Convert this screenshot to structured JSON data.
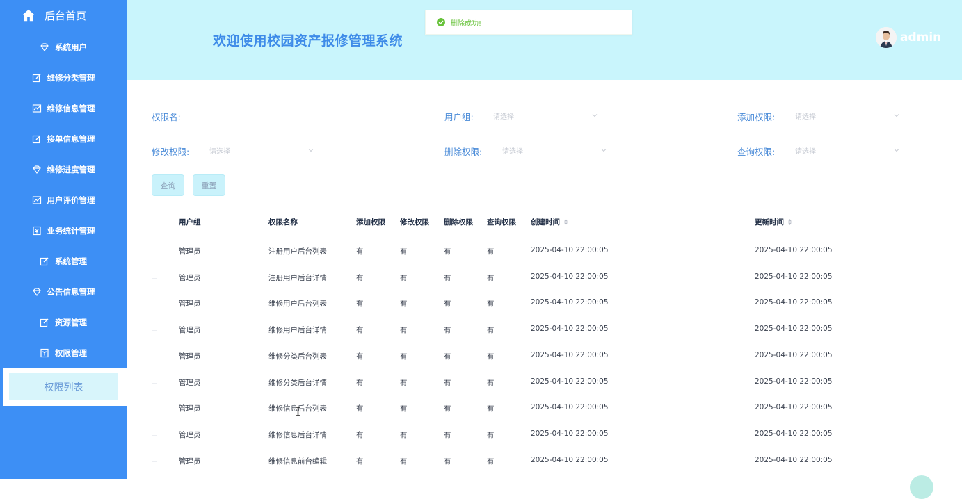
{
  "sidebar": {
    "home_label": "后台首页",
    "items": [
      {
        "label": "系统用户",
        "icon": "diamond-icon"
      },
      {
        "label": "维修分类管理",
        "icon": "edit-icon"
      },
      {
        "label": "维修信息管理",
        "icon": "chart-icon"
      },
      {
        "label": "接单信息管理",
        "icon": "edit-icon"
      },
      {
        "label": "维修进度管理",
        "icon": "diamond-icon"
      },
      {
        "label": "用户评价管理",
        "icon": "chart-icon"
      },
      {
        "label": "业务统计管理",
        "icon": "badge-icon"
      },
      {
        "label": "系统管理",
        "icon": "edit-icon"
      },
      {
        "label": "公告信息管理",
        "icon": "diamond-icon"
      },
      {
        "label": "资源管理",
        "icon": "edit-icon"
      },
      {
        "label": "权限管理",
        "icon": "badge-icon"
      }
    ],
    "active_sub": "权限列表"
  },
  "header": {
    "title": "欢迎使用校园资产报修管理系统",
    "username": "admin"
  },
  "toast": {
    "message": "删除成功!"
  },
  "filters": {
    "perm_name": "权限名:",
    "user_group": "用户组:",
    "add_perm": "添加权限:",
    "edit_perm": "修改权限:",
    "del_perm": "删除权限:",
    "query_perm": "查询权限:",
    "placeholder": "请选择"
  },
  "buttons": {
    "query": "查询",
    "reset": "重置"
  },
  "table": {
    "headers": [
      "用户组",
      "权限名称",
      "添加权限",
      "修改权限",
      "删除权限",
      "查询权限",
      "创建时间",
      "更新时间"
    ],
    "rows": [
      [
        "管理员",
        "注册用户后台列表",
        "有",
        "有",
        "有",
        "有",
        "2025-04-10 22:00:05",
        "2025-04-10 22:00:05"
      ],
      [
        "管理员",
        "注册用户后台详情",
        "有",
        "有",
        "有",
        "有",
        "2025-04-10 22:00:05",
        "2025-04-10 22:00:05"
      ],
      [
        "管理员",
        "维修用户后台列表",
        "有",
        "有",
        "有",
        "有",
        "2025-04-10 22:00:05",
        "2025-04-10 22:00:05"
      ],
      [
        "管理员",
        "维修用户后台详情",
        "有",
        "有",
        "有",
        "有",
        "2025-04-10 22:00:05",
        "2025-04-10 22:00:05"
      ],
      [
        "管理员",
        "维修分类后台列表",
        "有",
        "有",
        "有",
        "有",
        "2025-04-10 22:00:05",
        "2025-04-10 22:00:05"
      ],
      [
        "管理员",
        "维修分类后台详情",
        "有",
        "有",
        "有",
        "有",
        "2025-04-10 22:00:05",
        "2025-04-10 22:00:05"
      ],
      [
        "管理员",
        "维修信息后台列表",
        "有",
        "有",
        "有",
        "有",
        "2025-04-10 22:00:05",
        "2025-04-10 22:00:05"
      ],
      [
        "管理员",
        "维修信息后台详情",
        "有",
        "有",
        "有",
        "有",
        "2025-04-10 22:00:05",
        "2025-04-10 22:00:05"
      ],
      [
        "管理员",
        "维修信息前台编辑",
        "有",
        "有",
        "有",
        "有",
        "2025-04-10 22:00:05",
        "2025-04-10 22:00:05"
      ]
    ]
  }
}
